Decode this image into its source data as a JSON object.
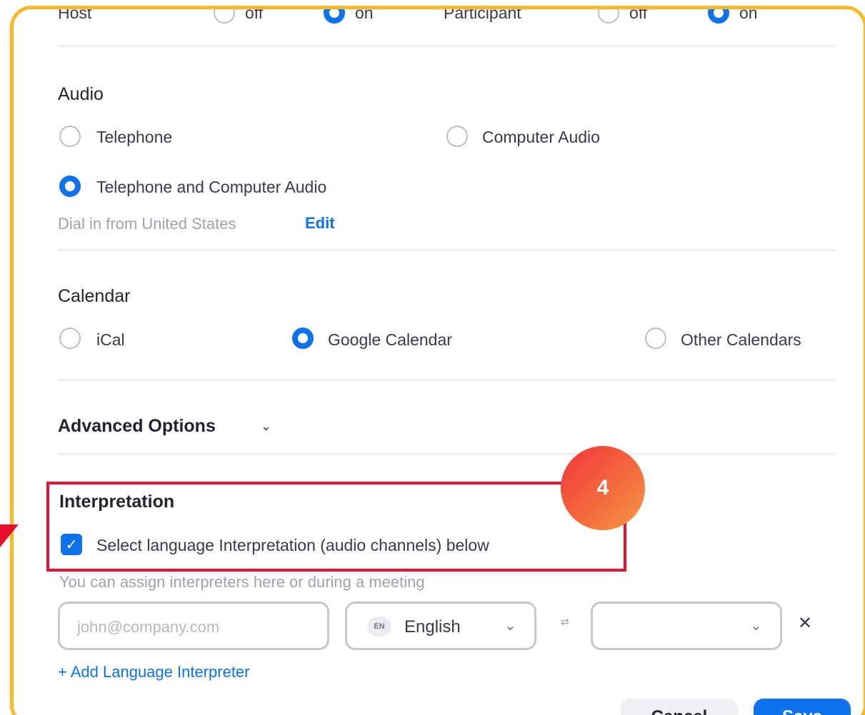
{
  "top_row": {
    "host_label": "Host",
    "host_off": "off",
    "host_on": "on",
    "participant_label": "Participant",
    "participant_off": "off",
    "participant_on": "on"
  },
  "audio": {
    "title": "Audio",
    "options": [
      "Telephone",
      "Computer Audio",
      "Telephone and Computer Audio"
    ],
    "selected": "Telephone and Computer Audio",
    "dial_in_text": "Dial in from United States",
    "edit_link": "Edit"
  },
  "calendar": {
    "title": "Calendar",
    "options": [
      "iCal",
      "Google Calendar",
      "Other Calendars"
    ],
    "selected": "Google Calendar"
  },
  "advanced": {
    "title": "Advanced Options",
    "chevron_icon": "chevron-down-icon"
  },
  "interpretation": {
    "title": "Interpretation",
    "checkbox_label": "Select language Interpretation (audio channels) below",
    "checked": true,
    "hint": "You can assign interpreters here or during a meeting",
    "email_placeholder": "john@company.com",
    "language_tag": "EN",
    "language_value": "English",
    "swap_icon": "swap-arrows-icon",
    "remove_icon": "close-icon",
    "add_link": "+ Add Language Interpreter"
  },
  "step_badge": "4",
  "buttons": {
    "cancel": "Cancel",
    "save": "Save"
  },
  "colors": {
    "accent": "#0e72ed",
    "frame": "#f7b928",
    "highlight": "#e8112d",
    "badge": "#f36a3d"
  }
}
